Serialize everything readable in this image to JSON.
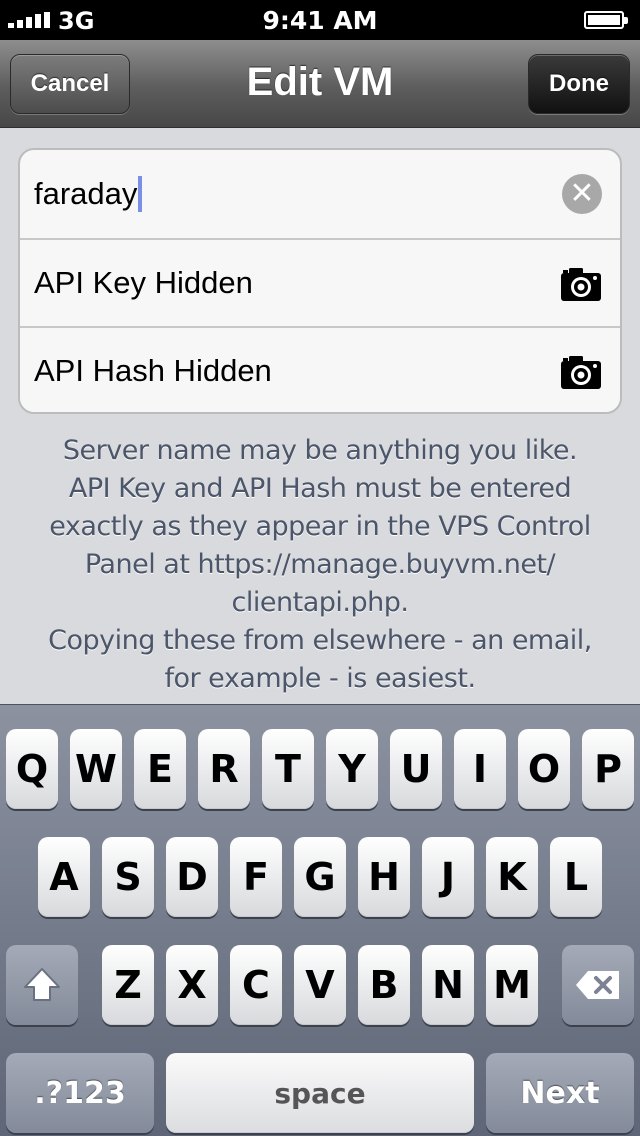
{
  "status_bar": {
    "carrier": "3G",
    "time": "9:41 AM"
  },
  "nav": {
    "title": "Edit VM",
    "cancel_label": "Cancel",
    "done_label": "Done"
  },
  "form": {
    "server_name_value": "faraday",
    "api_key_label": "API Key Hidden",
    "api_hash_label": "API Hash Hidden",
    "clear_glyph": "✕"
  },
  "help": {
    "lines": [
      "Server name may be anything you like.",
      "API Key and API Hash must be entered",
      "exactly as they appear in the VPS Control",
      "Panel at https://manage.buyvm.net/",
      "clientapi.php.",
      "Copying these from elsewhere - an email,",
      "for example - is easiest."
    ]
  },
  "keyboard": {
    "row1": [
      "Q",
      "W",
      "E",
      "R",
      "T",
      "Y",
      "U",
      "I",
      "O",
      "P"
    ],
    "row2": [
      "A",
      "S",
      "D",
      "F",
      "G",
      "H",
      "J",
      "K",
      "L"
    ],
    "row3": [
      "Z",
      "X",
      "C",
      "V",
      "B",
      "N",
      "M"
    ],
    "numbers_label": ".?123",
    "space_label": "space",
    "next_label": "Next",
    "shift_icon": "shift-icon",
    "delete_icon": "backspace-icon"
  },
  "colors": {
    "caret": "#7a8fe8",
    "help_text": "#4c566a",
    "nav_done": "#111111"
  }
}
